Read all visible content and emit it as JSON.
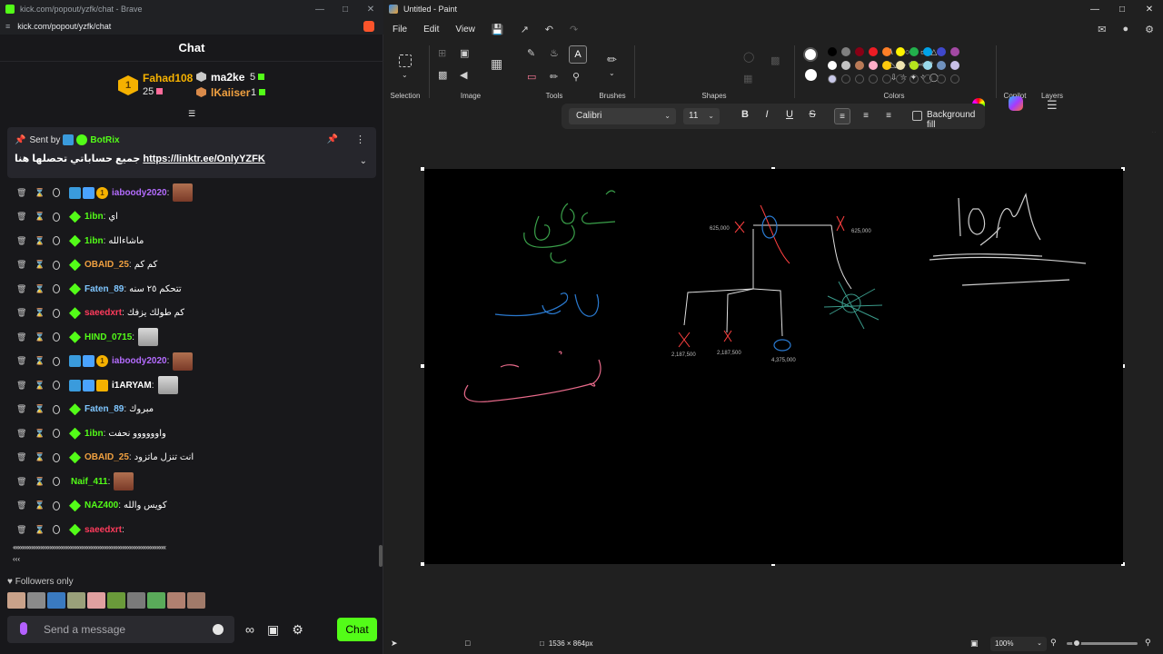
{
  "kick": {
    "window_title": "kick.com/popout/yzfk/chat - Brave",
    "url": "kick.com/popout/yzfk/chat",
    "chat_title": "Chat",
    "leaderboard": {
      "first": {
        "name": "Fahad108",
        "count": "25",
        "rank": "1"
      },
      "second": {
        "name": "ma2ke",
        "count": "5"
      },
      "third": {
        "name": "lKaiiser",
        "count": "1"
      }
    },
    "pinned": {
      "sent_by_label": "Sent by",
      "sender": "BotRix",
      "message_prefix": "جميع حساباتي تحصلها هنا",
      "link": "https://linktr.ee/OnlyYZFK"
    },
    "messages": [
      {
        "user": "iaboody2020",
        "text": "",
        "color": "#b46cff",
        "badges": [
          "blue",
          "mult",
          "coin"
        ],
        "avatar": "dark"
      },
      {
        "user": "1ibn",
        "text": "اي",
        "color": "#53fc18",
        "badges": [
          "green"
        ],
        "avatar": ""
      },
      {
        "user": "1ibn",
        "text": "ماشاءالله",
        "color": "#53fc18",
        "badges": [
          "green"
        ],
        "avatar": ""
      },
      {
        "user": "OBAID_25",
        "text": "كم كم",
        "color": "#f0a040",
        "badges": [
          "green"
        ],
        "avatar": ""
      },
      {
        "user": "Faten_89",
        "text": "تتحكم ٢٥ سنه",
        "color": "#7fc6ff",
        "badges": [
          "green"
        ],
        "avatar": ""
      },
      {
        "user": "saeedxrt",
        "text": "كم طولك يزفك",
        "color": "#ff3b5c",
        "badges": [
          "green"
        ],
        "avatar": ""
      },
      {
        "user": "HIND_0715",
        "text": "",
        "color": "#53fc18",
        "badges": [
          "green"
        ],
        "avatar": "light"
      },
      {
        "user": "iaboody2020",
        "text": "",
        "color": "#b46cff",
        "badges": [
          "blue",
          "mult",
          "coin"
        ],
        "avatar": "dark"
      },
      {
        "user": "i1ARYAM",
        "text": "",
        "color": "#ffffff",
        "badges": [
          "blue",
          "mult",
          "crown"
        ],
        "avatar": "light"
      },
      {
        "user": "Faten_89",
        "text": "مبروك",
        "color": "#7fc6ff",
        "badges": [
          "green"
        ],
        "avatar": ""
      },
      {
        "user": "1ibn",
        "text": "واوووووو نحفت",
        "color": "#53fc18",
        "badges": [
          "green"
        ],
        "avatar": ""
      },
      {
        "user": "OBAID_25",
        "text": "انت تنزل ماتزود",
        "color": "#f0a040",
        "badges": [
          "green"
        ],
        "avatar": ""
      },
      {
        "user": "Naif_411",
        "text": "",
        "color": "#53fc18",
        "badges": [],
        "avatar": "dark"
      },
      {
        "user": "NAZ400",
        "text": "كويس والله",
        "color": "#53fc18",
        "badges": [
          "green"
        ],
        "avatar": ""
      },
      {
        "user": "saeedxrt",
        "text": "",
        "color": "#ff3b5c",
        "badges": [
          "green"
        ],
        "avatar": ""
      }
    ],
    "emote_spam": "‹‹‹‹‹‹‹‹‹‹‹‹‹‹‹‹‹‹‹‹‹‹‹‹‹‹‹‹‹‹‹‹‹‹‹‹‹‹‹‹‹‹‹‹‹‹‹‹‹‹‹‹‹‹‹‹‹‹‹‹‹‹‹‹‹‹‹‹‹‹‹‹‹‹‹‹‹‹‹‹‹‹‹‹‹‹‹‹‹‹‹‹‹‹‹‹‹‹‹‹‹",
    "emote_spam2": "‹‹‹",
    "followers_only": "Followers only",
    "send_placeholder": "Send a message",
    "chat_button": "Chat"
  },
  "paint": {
    "window_title": "Untitled - Paint",
    "menu": {
      "file": "File",
      "edit": "Edit",
      "view": "View"
    },
    "groups": {
      "selection": "Selection",
      "image": "Image",
      "tools": "Tools",
      "brushes": "Brushes",
      "shapes": "Shapes",
      "colors": "Colors",
      "copilot": "Copilot",
      "layers": "Layers"
    },
    "text_toolbar": {
      "font": "Calibri",
      "size": "11",
      "background_fill": "Background fill"
    },
    "canvas_labels": {
      "l1": "625,000",
      "l2": "625,000",
      "l3": "2,187,500",
      "l4": "2,187,500",
      "l5": "4,375,000"
    },
    "status": {
      "dimensions": "1536 × 864px",
      "zoom": "100%"
    },
    "colors": {
      "row1": [
        "#000000",
        "#7f7f7f",
        "#880015",
        "#ed1c24",
        "#ff7f27",
        "#fff200",
        "#22b14c",
        "#00a2e8",
        "#3f48cc",
        "#a349a4"
      ],
      "row2": [
        "#ffffff",
        "#c3c3c3",
        "#b97a57",
        "#ffaec9",
        "#ffc90e",
        "#efe4b0",
        "#b5e61d",
        "#99d9ea",
        "#7092be",
        "#c8bfe7"
      ]
    }
  }
}
